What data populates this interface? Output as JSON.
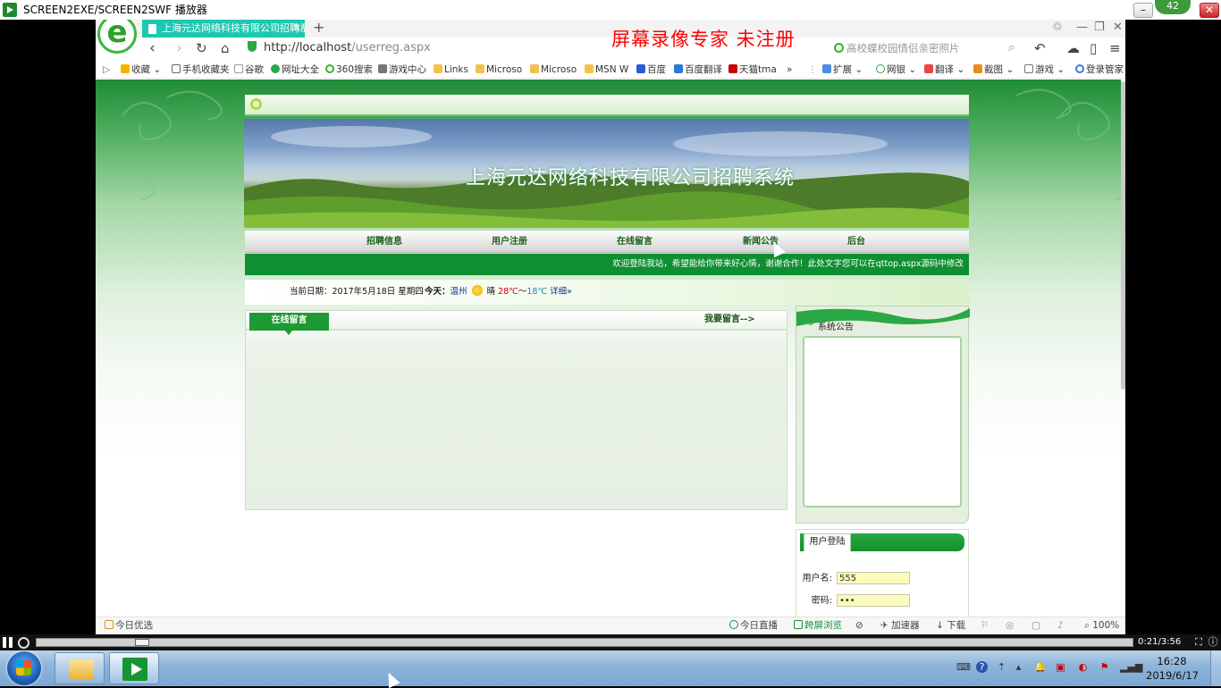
{
  "player": {
    "title": "SCREEN2EXE/SCREEN2SWF 播放器",
    "badge": "42",
    "time": "0:21/3:56"
  },
  "browser": {
    "tab_title": "上海元达网络科技有限公司招聘系",
    "watermark": "屏幕录像专家  未注册",
    "url_host": "http://localhost",
    "url_path": "/userreg.aspx",
    "search_placeholder": "高校蝶校园情侣亲密照片",
    "bookmarks": [
      "收藏",
      "手机收藏夹",
      "谷歌",
      "网址大全",
      "360搜索",
      "游戏中心",
      "Links",
      "Microso",
      "Microso",
      "MSN W",
      "百度",
      "百度翻译",
      "天猫tma",
      "»"
    ],
    "ext": [
      "扩展",
      "网银",
      "翻译",
      "截图",
      "游戏",
      "登录管家"
    ],
    "status": {
      "left": "今日优选",
      "live": "今日直播",
      "cast": "跨屏浏览",
      "speed": "加速器",
      "download": "下载",
      "zoom": "100%"
    }
  },
  "site": {
    "banner_title": "上海元达网络科技有限公司招聘系统",
    "nav": [
      "招聘信息",
      "用户注册",
      "在线留言",
      "新闻公告",
      "后台"
    ],
    "marquee": "欢迎登陆我站，希望能给你带来好心情，谢谢合作！此处文字您可以在qttop.aspx源码中修改",
    "date_label": "当前日期：2017年5月18日 星期四",
    "today_label": "今天：",
    "city": "温州",
    "weather": "晴",
    "temp_high": "28℃",
    "temp_sep": "～",
    "temp_low": "18℃",
    "detail_link": "详细»",
    "guestbook_tab": "在线留言",
    "guestbook_link": "我要留言-->",
    "notice_title": "系统公告",
    "login_tab": "用户登陆",
    "username_label": "用户名:",
    "username_value": "555",
    "password_label": "密码:",
    "password_value": "•••"
  },
  "taskbar": {
    "time": "16:28",
    "date": "2019/6/17"
  },
  "colors": {
    "accent_green": "#0e8f31",
    "watermark_red": "#ff0000",
    "tab_teal": "#1ec8b0"
  }
}
